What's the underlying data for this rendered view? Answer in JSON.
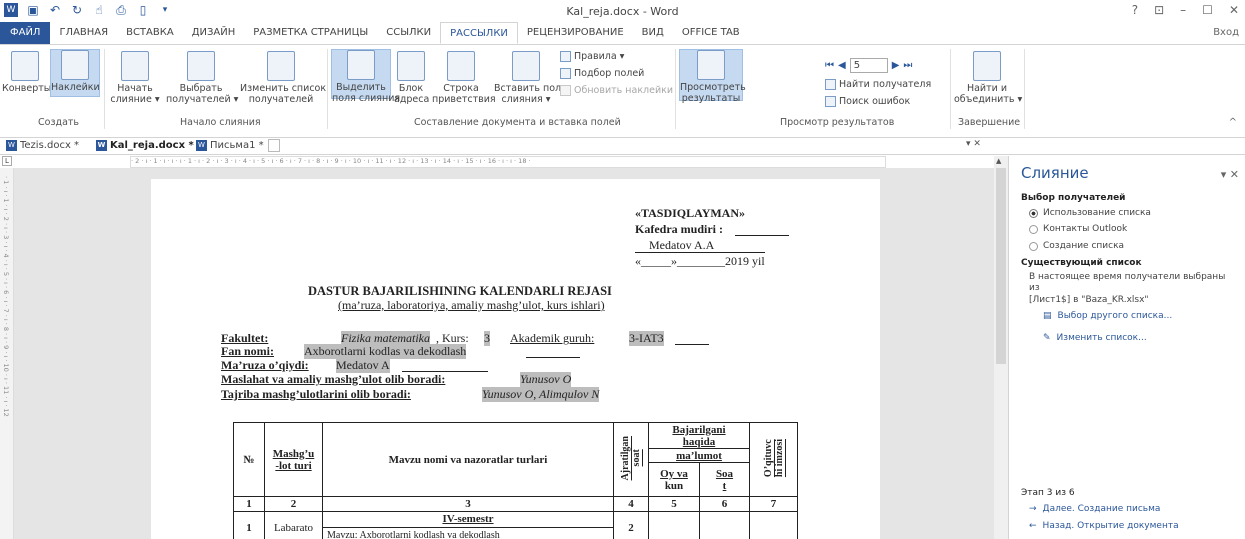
{
  "app": {
    "title": "Kal_reja.docx - Word",
    "login": "Вход"
  },
  "window_controls": [
    "?",
    "⊡",
    "–",
    "☐",
    "✕"
  ],
  "tabs": [
    "ФАЙЛ",
    "ГЛАВНАЯ",
    "ВСТАВКА",
    "ДИЗАЙН",
    "РАЗМЕТКА СТРАНИЦЫ",
    "ССЫЛКИ",
    "РАССЫЛКИ",
    "РЕЦЕНЗИРОВАНИЕ",
    "ВИД",
    "OFFICE TAB"
  ],
  "ribbon": {
    "create": {
      "envelopes": "Конверты",
      "labels": "Наклейки",
      "group": "Создать"
    },
    "start": {
      "start_merge_1": "Начать",
      "start_merge_2": "слияние ▾",
      "select_1": "Выбрать",
      "select_2": "получателей ▾",
      "edit_1": "Изменить список",
      "edit_2": "получателей",
      "group": "Начало слияния"
    },
    "write": {
      "highlight_1": "Выделить",
      "highlight_2": "поля слияния",
      "block_1": "Блок",
      "block_2": "адреса",
      "greeting_1": "Строка",
      "greeting_2": "приветствия",
      "insert_1": "Вставить поле",
      "insert_2": "слияния ▾",
      "rules": "Правила ▾",
      "match": "Подбор полей",
      "update": "Обновить наклейки",
      "group": "Составление документа и вставка полей"
    },
    "preview": {
      "view_1": "Просмотреть",
      "view_2": "результаты",
      "record": "5",
      "find_recipient": "Найти получателя",
      "check_errors": "Поиск ошибок",
      "group": "Просмотр результатов"
    },
    "finish": {
      "find_1": "Найти и",
      "find_2": "объединить ▾",
      "group": "Завершение"
    }
  },
  "doctabs": [
    "Tezis.docx *",
    "Kal_reja.docx *",
    "Письма1 *"
  ],
  "ruler_text": "· 2 · ı · 1 · ı · ı · ı · 1 · ı · 2 · ı · 3 · ı · 4 · ı · 5 · ı · 6 · ı · 7 · ı · 8 · ı · 9 · ı · 10 · ı · 11 · ı · 12 · ı · 13 · ı · 14 · ı · 15 · ı · 16 · ı · ı · 18 ·",
  "vruler_text": "· 1 · ı · 1 · ı · 2 · ı · 3 · ı · 4 · ı · 5 · ı · 6 · ı · 7 · ı · 8 · ı · 9 · ı · 10 · ı · 11 · ı · 12",
  "document": {
    "approve": "«TASDIQLAYMAN»",
    "head": "Kafedra mudiri :",
    "head_name": "Medatov A.A",
    "date": "«_____»________2019 yil",
    "title": "DASTUR BAJARILISHINING KALENDARLI REJASI",
    "subtitle": "(ma’ruza, laboratoriya, amaliy mashg’ulot, kurs ishlari)",
    "fak_label": "Fakultet:",
    "fak_value": "Fizika matematika",
    "kurs_label": ", Kurs:",
    "kurs_value": "3",
    "group_label": "Akademik guruh:",
    "group_value": "3-IAT3",
    "fan_label": "Fan nomi:",
    "fan_value": "Axborotlarni kodlas va dekodlash",
    "lecturer_label": "Ma’ruza o’qiydi:",
    "lecturer_value": "Medatov A",
    "practice_label": "Maslahat va amaliy mashg’ulot olib boradi:",
    "practice_value": "Yunusov O",
    "lab_label": "Tajriba mashg’ulotlarini olib boradi:",
    "lab_value": "Yunusov O, Alimqulov N",
    "table": {
      "h_no": "№",
      "h_type_1": "Mashg’u",
      "h_type_2": "-lot turi",
      "h_topic": "Mavzu nomi va nazoratlar turlari",
      "h_hours_1": "Ajratilgan",
      "h_hours_2": "soat",
      "h_done_1": "Bajarilgani",
      "h_done_2": "haqida",
      "h_done_3": "ma’lumot",
      "h_date_1": "Oy va",
      "h_date_2": "kun",
      "h_hour_1": "Soa",
      "h_hour_2": "t",
      "h_sign_1": "O’qituvc",
      "h_sign_2": "hi imzosi",
      "numbers": [
        "1",
        "2",
        "3",
        "4",
        "5",
        "6",
        "7"
      ],
      "semester": "IV-semestr",
      "row1_no": "1",
      "row1_type": "Labarato",
      "row1_topic": "Mavzu: Axborotlarni kodlash va dekodlash",
      "row1_hours": "2"
    }
  },
  "mailmerge": {
    "title": "Слияние",
    "recipients_header": "Выбор получателей",
    "opt1": "Использование списка",
    "opt2": "Контакты Outlook",
    "opt3": "Создание списка",
    "existing_header": "Существующий список",
    "existing_text1": "В настоящее время получатели выбраны",
    "existing_text2": "из",
    "existing_text3": "[Лист1$] в \"Baza_KR.xlsx\"",
    "link1": "Выбор другого списка...",
    "link2": "Изменить список...",
    "step": "Этап 3 из 6",
    "next": "Далее. Создание письма",
    "prev": "Назад. Открытие документа"
  }
}
